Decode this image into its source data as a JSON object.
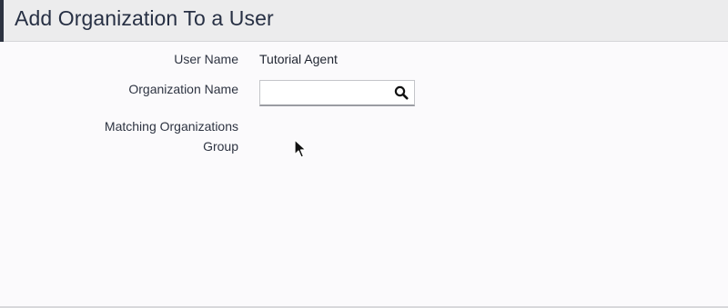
{
  "header": {
    "title": "Add Organization To a User"
  },
  "form": {
    "user_name_label": "User Name",
    "user_name_value": "Tutorial Agent",
    "organization_name_label": "Organization Name",
    "organization_name_value": "",
    "matching_label_line1": "Matching Organizations",
    "matching_label_line2": "Group"
  },
  "icons": {
    "search": "search-icon",
    "cursor": "mouse-pointer-icon"
  },
  "colors": {
    "header_background": "#ececed",
    "header_accent": "#2c3240",
    "title_text": "#273044",
    "page_background": "#fbfafc"
  }
}
